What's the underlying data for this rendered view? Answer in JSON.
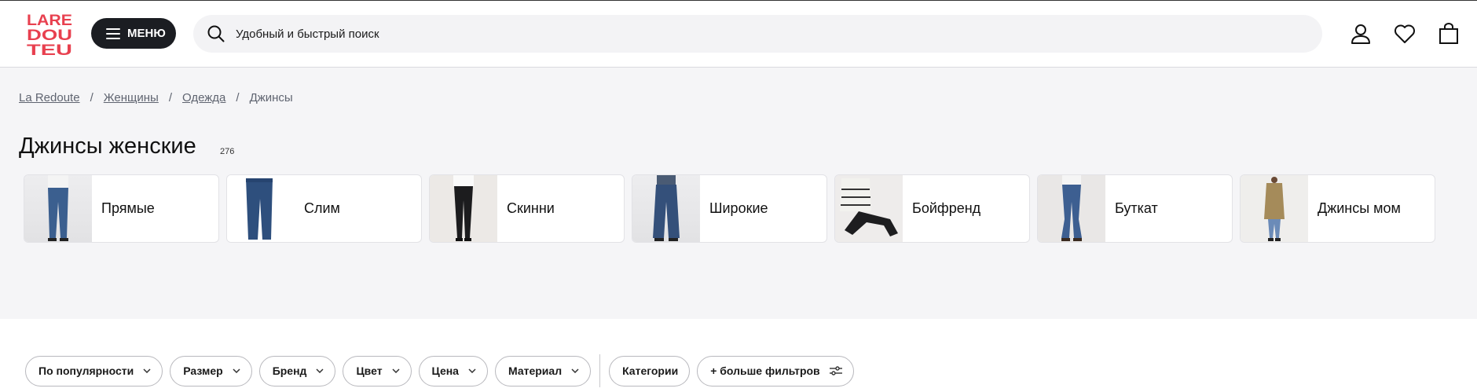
{
  "header": {
    "logo_text": "LA REDOUTE",
    "menu_label": "МЕНЮ",
    "search_placeholder": "Удобный и быстрый поиск"
  },
  "breadcrumb": [
    {
      "label": "La Redoute"
    },
    {
      "label": "Женщины"
    },
    {
      "label": "Одежда"
    },
    {
      "label": "Джинсы"
    }
  ],
  "page": {
    "title": "Джинсы женские",
    "count": "276"
  },
  "categories": [
    {
      "label": "Прямые"
    },
    {
      "label": "Слим"
    },
    {
      "label": "Скинни"
    },
    {
      "label": "Широкие"
    },
    {
      "label": "Бойфренд"
    },
    {
      "label": "Буткат"
    },
    {
      "label": "Джинсы мом"
    }
  ],
  "filters": {
    "items": [
      {
        "label": "По популярности"
      },
      {
        "label": "Размер"
      },
      {
        "label": "Бренд"
      },
      {
        "label": "Цвет"
      },
      {
        "label": "Цена"
      },
      {
        "label": "Материал"
      }
    ],
    "categories_label": "Категории",
    "more_label": "+ больше фильтров"
  },
  "colors": {
    "brand": "#e8404f",
    "dark": "#1b1d22",
    "band": "#f5f5f7",
    "denim": "#3b5f8f"
  }
}
